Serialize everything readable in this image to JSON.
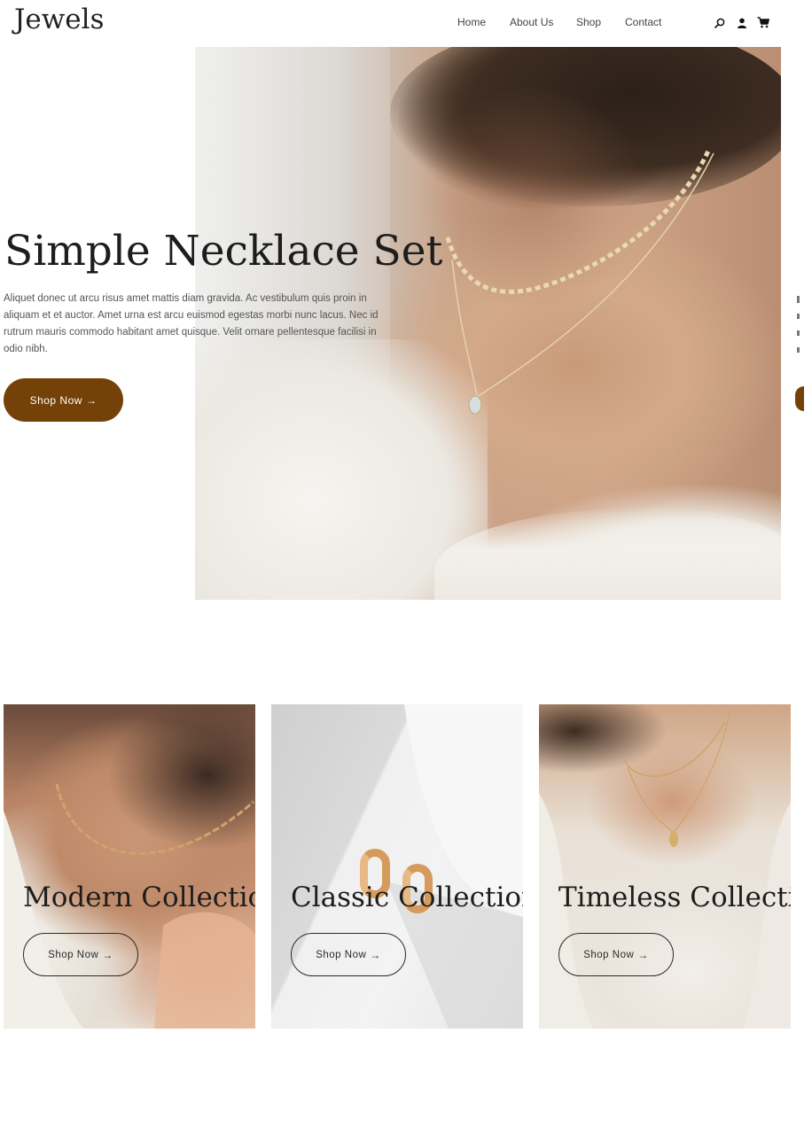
{
  "header": {
    "logo": "Jewels",
    "nav": [
      "Home",
      "About Us",
      "Shop",
      "Contact"
    ],
    "icons": [
      "search-icon",
      "user-icon",
      "cart-icon"
    ]
  },
  "hero": {
    "title": "Simple Necklace Set",
    "text": "Aliquet donec ut arcu risus amet mattis diam gravida. Ac vestibulum quis proin in aliquam et et auctor. Amet urna est arcu euismod egestas morbi nunc lacus. Nec id rutrum mauris commodo habitant amet quisque. Velit ornare pellentesque facilisi in odio nibh.",
    "button": "Shop Now",
    "button_color": "#744109"
  },
  "collections": [
    {
      "title": "Modern Collection",
      "button": "Shop Now"
    },
    {
      "title": "Classic Collection",
      "button": "Shop Now"
    },
    {
      "title": "Timeless Collection",
      "button": "Shop Now"
    }
  ]
}
